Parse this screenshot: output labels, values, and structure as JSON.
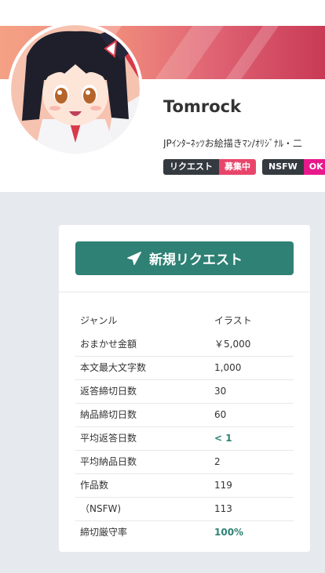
{
  "profile": {
    "name": "Tomrock",
    "bio": "JPｲﾝﾀｰﾈｯﾂお絵描きﾏﾝ/ｵﾘｼﾞﾅﾙ・二",
    "badges": [
      {
        "key": "リクエスト",
        "value": "募集中",
        "color": "#e8456b"
      },
      {
        "key": "NSFW",
        "value": "OK",
        "color": "#e8198b"
      }
    ]
  },
  "request_button": {
    "label": "新規リクエスト",
    "icon": "paper-plane-icon",
    "color": "#2e8174"
  },
  "stats": [
    {
      "label": "ジャンル",
      "value": "イラスト",
      "accent": false
    },
    {
      "label": "おまかせ金額",
      "value": "￥5,000",
      "accent": false
    },
    {
      "label": "本文最大文字数",
      "value": "1,000",
      "accent": false
    },
    {
      "label": "返答締切日数",
      "value": "30",
      "accent": false
    },
    {
      "label": "納品締切日数",
      "value": "60",
      "accent": false
    },
    {
      "label": "平均返答日数",
      "value": "< 1",
      "accent": true
    },
    {
      "label": "平均納品日数",
      "value": "2",
      "accent": false
    },
    {
      "label": "作品数",
      "value": "119",
      "accent": false
    },
    {
      "label": "（NSFW)",
      "value": "113",
      "accent": false
    },
    {
      "label": "締切厳守率",
      "value": "100%",
      "accent": true
    }
  ]
}
